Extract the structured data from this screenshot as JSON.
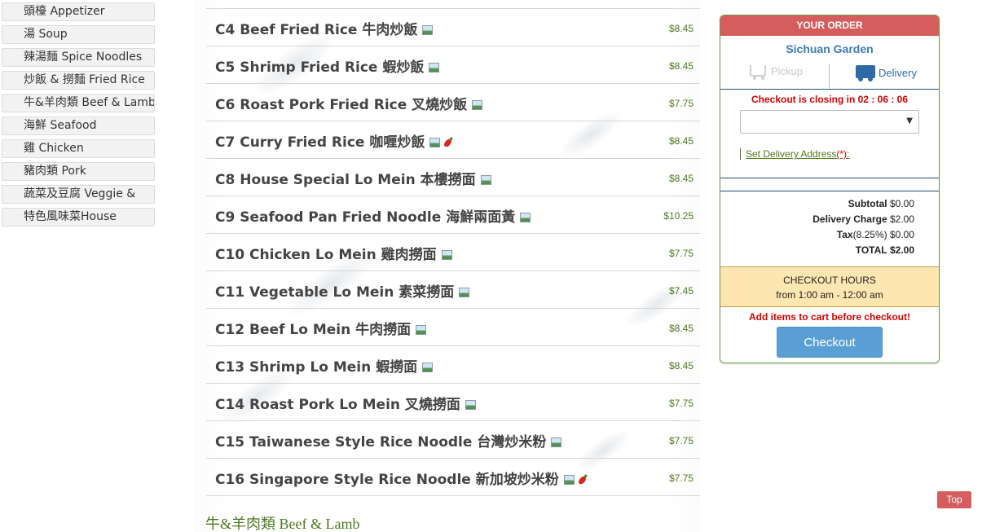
{
  "sidebar": {
    "categories": [
      "頭檯 Appetizer",
      "湯 Soup",
      "辣湯麵 Spice Noodles",
      "炒飯 & 撈麵 Fried Rice",
      "牛&羊肉類 Beef & Lamb",
      "海鮮 Seafood",
      "雞 Chicken",
      "豬肉類 Pork",
      "蔬菜及豆腐 Veggie &",
      "特色風味菜House"
    ]
  },
  "menu": {
    "items": [
      {
        "name": "C4 Beef Fried Rice 牛肉炒飯",
        "price": "$8.45",
        "spicy": false
      },
      {
        "name": "C5 Shrimp Fried Rice 蝦炒飯",
        "price": "$8.45",
        "spicy": false
      },
      {
        "name": "C6 Roast Pork Fried Rice 叉燒炒飯",
        "price": "$7.75",
        "spicy": false
      },
      {
        "name": "C7 Curry Fried Rice 咖喱炒飯",
        "price": "$8.45",
        "spicy": true
      },
      {
        "name": "C8 House Special Lo Mein 本樓撈面",
        "price": "$8.45",
        "spicy": false
      },
      {
        "name": "C9 Seafood Pan Fried Noodle 海鮮兩面黃",
        "price": "$10.25",
        "spicy": false
      },
      {
        "name": "C10 Chicken Lo Mein 雞肉撈面",
        "price": "$7.75",
        "spicy": false
      },
      {
        "name": "C11 Vegetable Lo Mein 素菜撈面",
        "price": "$7.45",
        "spicy": false
      },
      {
        "name": "C12 Beef Lo Mein 牛肉撈面",
        "price": "$8.45",
        "spicy": false
      },
      {
        "name": "C13 Shrimp Lo Mein 蝦撈面",
        "price": "$8.45",
        "spicy": false
      },
      {
        "name": "C14 Roast Pork Lo Mein 叉燒撈面",
        "price": "$7.75",
        "spicy": false
      },
      {
        "name": "C15 Taiwanese Style Rice Noodle 台灣炒米粉",
        "price": "$7.75",
        "spicy": false
      },
      {
        "name": "C16 Singapore Style Rice Noodle 新加坡炒米粉",
        "price": "$7.75",
        "spicy": true
      }
    ],
    "next_section": "牛&羊肉類 Beef & Lamb"
  },
  "order": {
    "header": "YOUR ORDER",
    "restaurant": "Sichuan Garden",
    "pickup_label": "Pickup",
    "delivery_label": "Delivery",
    "closing_text": "Checkout is closing in 02 : 06 : 06",
    "select_value": "",
    "address_link": "Set Delivery Address",
    "address_required": "(*):",
    "subtotal_label": "Subtotal",
    "subtotal_value": "$0.00",
    "delivery_charge_label": "Delivery Charge",
    "delivery_charge_value": "$2.00",
    "tax_label": "Tax",
    "tax_rate": "(8.25%)",
    "tax_value": "$0.00",
    "total_label": "TOTAL",
    "total_value": "$2.00",
    "hours_title": "CHECKOUT HOURS",
    "hours_range": "from 1:00 am - 12:00 am",
    "add_items_msg": "Add items to cart before checkout!",
    "checkout_label": "Checkout"
  },
  "top_button": "Top",
  "colors": {
    "accent_red": "#d65d5d",
    "price_green": "#4c7a1e",
    "link_blue": "#3b7ab8",
    "checkout_blue": "#5a9fd4",
    "hours_bg": "#fde6b0"
  },
  "icons": {
    "photo": "photo-icon",
    "chili": "chili-pepper-icon",
    "pickup": "cart-icon",
    "delivery": "truck-icon"
  }
}
